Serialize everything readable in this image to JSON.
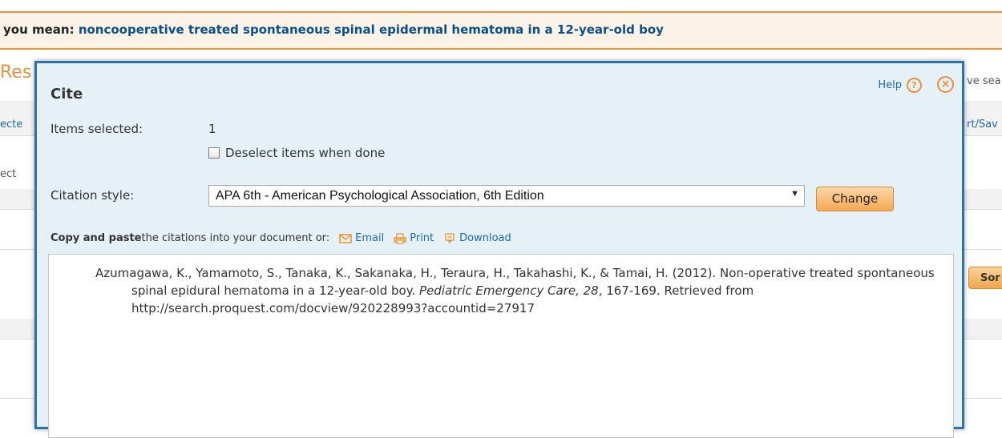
{
  "background": {
    "suggest_prefix": "you mean: ",
    "suggest_link": "noncooperative treated spontaneous spinal epidermal hematoma in a 12-year-old boy",
    "results_fragment": "Res",
    "selected_fragment": "ecte",
    "select_fragment": "ect",
    "save_search_fragment": "ve sea",
    "export_fragment": "rt/Sav",
    "sort_fragment": "Sor"
  },
  "dialog": {
    "title": "Cite",
    "help_label": "Help",
    "items_selected_label": "Items selected:",
    "items_selected_value": "1",
    "deselect_label": "Deselect items when done",
    "citation_style_label": "Citation style:",
    "citation_style_value": "APA 6th - American Psychological Association, 6th Edition",
    "change_button": "Change",
    "copy_bold": "Copy and paste",
    "copy_rest": " the citations into your document or:",
    "email_label": "Email",
    "print_label": "Print",
    "download_label": "Download",
    "citation": {
      "authors": "Azumagawa, K., Yamamoto, S., Tanaka, K., Sakanaka, H., Teraura, H., Takahashi, K., & Tamai, H. (2012). Non-operative treated spontaneous spinal epidural hematoma in a 12-year-old boy. ",
      "journal": "Pediatric Emergency Care, 28",
      "rest": ", 167-169. Retrieved from http://search.proquest.com/docview/920228993?accountid=27917"
    }
  },
  "colors": {
    "accent_orange": "#e8923a",
    "dialog_border": "#2b73aa",
    "link_blue": "#1a6bb0"
  },
  "icons": [
    "help-icon",
    "close-icon",
    "email-icon",
    "print-icon",
    "download-icon",
    "chevron-down-icon"
  ]
}
